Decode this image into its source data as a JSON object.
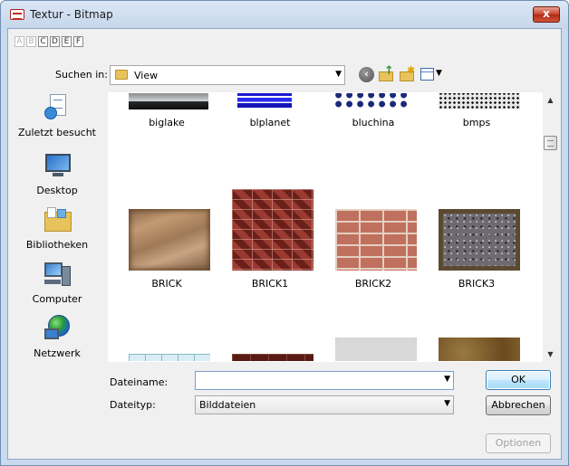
{
  "window": {
    "title": "Textur - Bitmap",
    "close_glyph": "x"
  },
  "drives": [
    {
      "letter": "A",
      "enabled": false
    },
    {
      "letter": "B",
      "enabled": false
    },
    {
      "letter": "C",
      "enabled": true
    },
    {
      "letter": "D",
      "enabled": true
    },
    {
      "letter": "E",
      "enabled": true
    },
    {
      "letter": "F",
      "enabled": true
    }
  ],
  "lookin": {
    "label": "Suchen in:",
    "value": "View",
    "icons": [
      "back-icon",
      "up-folder-icon",
      "new-folder-icon",
      "view-menu-icon"
    ]
  },
  "places": [
    {
      "label": "Zuletzt besucht",
      "icon": "recent-places-icon"
    },
    {
      "label": "Desktop",
      "icon": "desktop-icon"
    },
    {
      "label": "Bibliotheken",
      "icon": "libraries-icon"
    },
    {
      "label": "Computer",
      "icon": "computer-icon"
    },
    {
      "label": "Netzwerk",
      "icon": "network-icon"
    }
  ],
  "files": [
    {
      "name": "biglake"
    },
    {
      "name": "blplanet"
    },
    {
      "name": "bluchina"
    },
    {
      "name": "bmps"
    },
    {
      "name": "BRICK"
    },
    {
      "name": "BRICK1"
    },
    {
      "name": "BRICK2"
    },
    {
      "name": "BRICK3"
    }
  ],
  "filename": {
    "label": "Dateiname:",
    "value": ""
  },
  "filetype": {
    "label": "Dateityp:",
    "value": "Bilddateien"
  },
  "buttons": {
    "ok": "OK",
    "cancel": "Abbrechen",
    "options": "Optionen"
  },
  "colors": {
    "accent": "#3c7fb1",
    "close_red": "#c9422a"
  }
}
